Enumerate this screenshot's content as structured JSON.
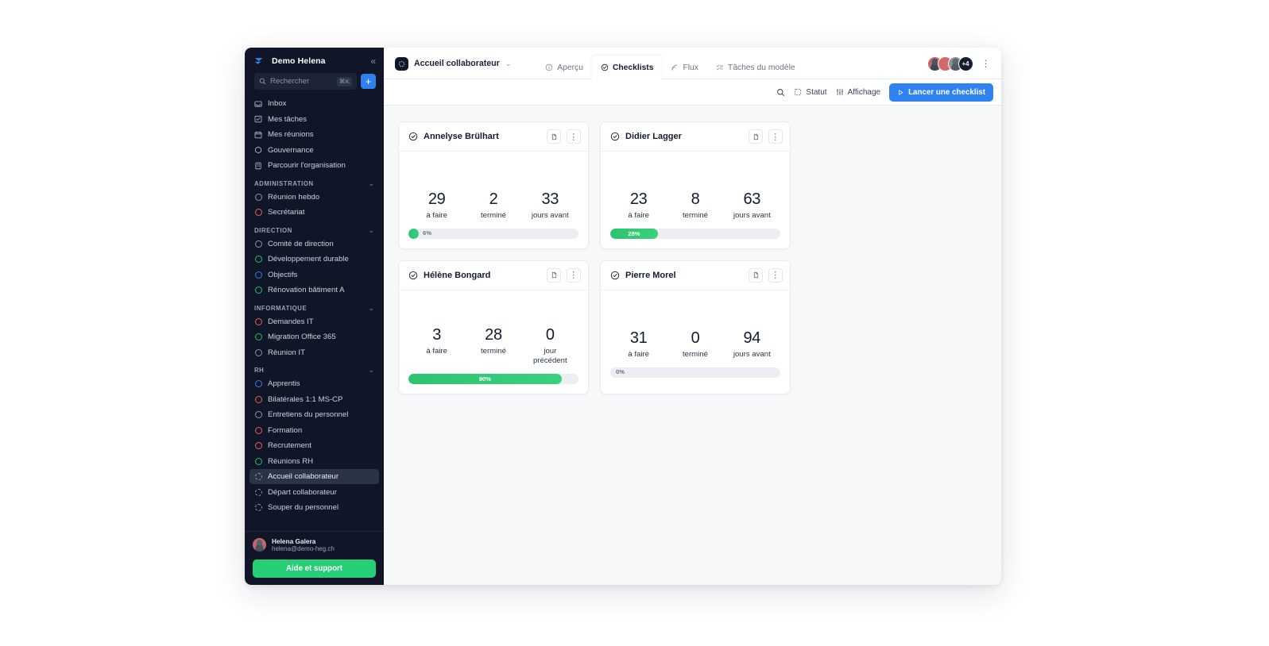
{
  "sidebar": {
    "brand": "Demo Helena",
    "collapse_icon": "chevrons-left-icon",
    "search": {
      "placeholder": "Rechercher",
      "shortcut": "⌘K",
      "icon": "search-icon"
    },
    "add_button_label": "+",
    "nav": [
      {
        "label": "Inbox",
        "icon": "inbox-icon",
        "dot": null
      },
      {
        "label": "Mes tâches",
        "icon": "check-square-icon",
        "dot": null
      },
      {
        "label": "Mes réunions",
        "icon": "calendar-icon",
        "dot": null
      },
      {
        "label": "Gouvernance",
        "icon": "hexagon-icon",
        "dot": null
      },
      {
        "label": "Parcourir l'organisation",
        "icon": "building-icon",
        "dot": null
      }
    ],
    "groups": [
      {
        "label": "ADMINISTRATION",
        "items": [
          {
            "label": "Réunion hebdo",
            "dot": "gray"
          },
          {
            "label": "Secrétariat",
            "dot": "red"
          }
        ]
      },
      {
        "label": "DIRECTION",
        "items": [
          {
            "label": "Comité de direction",
            "dot": "gray"
          },
          {
            "label": "Développement durable",
            "dot": "green"
          },
          {
            "label": "Objectifs",
            "dot": "blue"
          },
          {
            "label": "Rénovation bâtiment A",
            "dot": "green"
          }
        ]
      },
      {
        "label": "INFORMATIQUE",
        "items": [
          {
            "label": "Demandes IT",
            "dot": "red"
          },
          {
            "label": "Migration Office 365",
            "dot": "green"
          },
          {
            "label": "Réunion IT",
            "dot": "gray"
          }
        ]
      },
      {
        "label": "RH",
        "items": [
          {
            "label": "Apprentis",
            "dot": "blue"
          },
          {
            "label": "Bilatérales 1:1 MS-CP",
            "dot": "red"
          },
          {
            "label": "Entretiens du personnel",
            "dot": "gray"
          },
          {
            "label": "Formation",
            "dot": "red"
          },
          {
            "label": "Recrutement",
            "dot": "red"
          },
          {
            "label": "Réunions RH",
            "dot": "green"
          },
          {
            "label": "Accueil collaborateur",
            "dot": "dashed",
            "active": true
          },
          {
            "label": "Départ collaborateur",
            "dot": "dashed"
          },
          {
            "label": "Souper du personnel",
            "dot": "dashed"
          }
        ]
      }
    ],
    "user": {
      "name": "Helena Galera",
      "email": "helena@demo-heg.ch",
      "avatar": "user-avatar"
    },
    "help_button": "Aide et support"
  },
  "topbar": {
    "doc_icon": "dashed-circle-icon",
    "doc_name": "Accueil collaborateur",
    "doc_caret": "chevron-down-icon",
    "tabs": [
      {
        "label": "Aperçu",
        "icon": "info-icon",
        "active": false
      },
      {
        "label": "Checklists",
        "icon": "check-circle-icon",
        "active": true
      },
      {
        "label": "Flux",
        "icon": "rss-icon",
        "active": false
      },
      {
        "label": "Tâches du modèle",
        "icon": "list-checks-icon",
        "active": false
      }
    ],
    "avatar_overflow": "+4",
    "overflow_menu_icon": "kebab-icon"
  },
  "actionbar": {
    "search_icon": "search-icon",
    "status": {
      "label": "Statut",
      "icon": "dashed-square-icon"
    },
    "display": {
      "label": "Affichage",
      "icon": "sliders-icon"
    },
    "primary": {
      "label": "Lancer une checklist",
      "icon": "play-icon"
    }
  },
  "cards": [
    {
      "title": "Annelyse Brülhart",
      "status_icon": "check-circle-icon",
      "doc_icon": "file-icon",
      "menu_icon": "kebab-icon",
      "stats": [
        {
          "value": "29",
          "label": "à faire"
        },
        {
          "value": "2",
          "label": "terminé"
        },
        {
          "value": "33",
          "label": "jours avant"
        }
      ],
      "progress": {
        "percent": 6,
        "text": "6%"
      }
    },
    {
      "title": "Didier Lagger",
      "status_icon": "check-circle-icon",
      "doc_icon": "file-icon",
      "menu_icon": "kebab-icon",
      "stats": [
        {
          "value": "23",
          "label": "à faire"
        },
        {
          "value": "8",
          "label": "terminé"
        },
        {
          "value": "63",
          "label": "jours avant"
        }
      ],
      "progress": {
        "percent": 28,
        "text": "28%"
      }
    },
    {
      "title": "Hélène Bongard",
      "status_icon": "check-circle-icon",
      "doc_icon": "file-icon",
      "menu_icon": "kebab-icon",
      "stats": [
        {
          "value": "3",
          "label": "à faire"
        },
        {
          "value": "28",
          "label": "terminé"
        },
        {
          "value": "0",
          "label": "jour précédent"
        }
      ],
      "progress": {
        "percent": 90,
        "text": "90%"
      }
    },
    {
      "title": "Pierre Morel",
      "status_icon": "check-circle-icon",
      "doc_icon": "file-icon",
      "menu_icon": "kebab-icon",
      "stats": [
        {
          "value": "31",
          "label": "à faire"
        },
        {
          "value": "0",
          "label": "terminé"
        },
        {
          "value": "94",
          "label": "jours avant"
        }
      ],
      "progress": {
        "percent": 0,
        "text": "0%"
      }
    }
  ],
  "colors": {
    "accent_blue": "#2f82f2",
    "green": "#26cf76",
    "sidebar_bg": "#101628",
    "canvas_bg": "#f7f8fa"
  }
}
